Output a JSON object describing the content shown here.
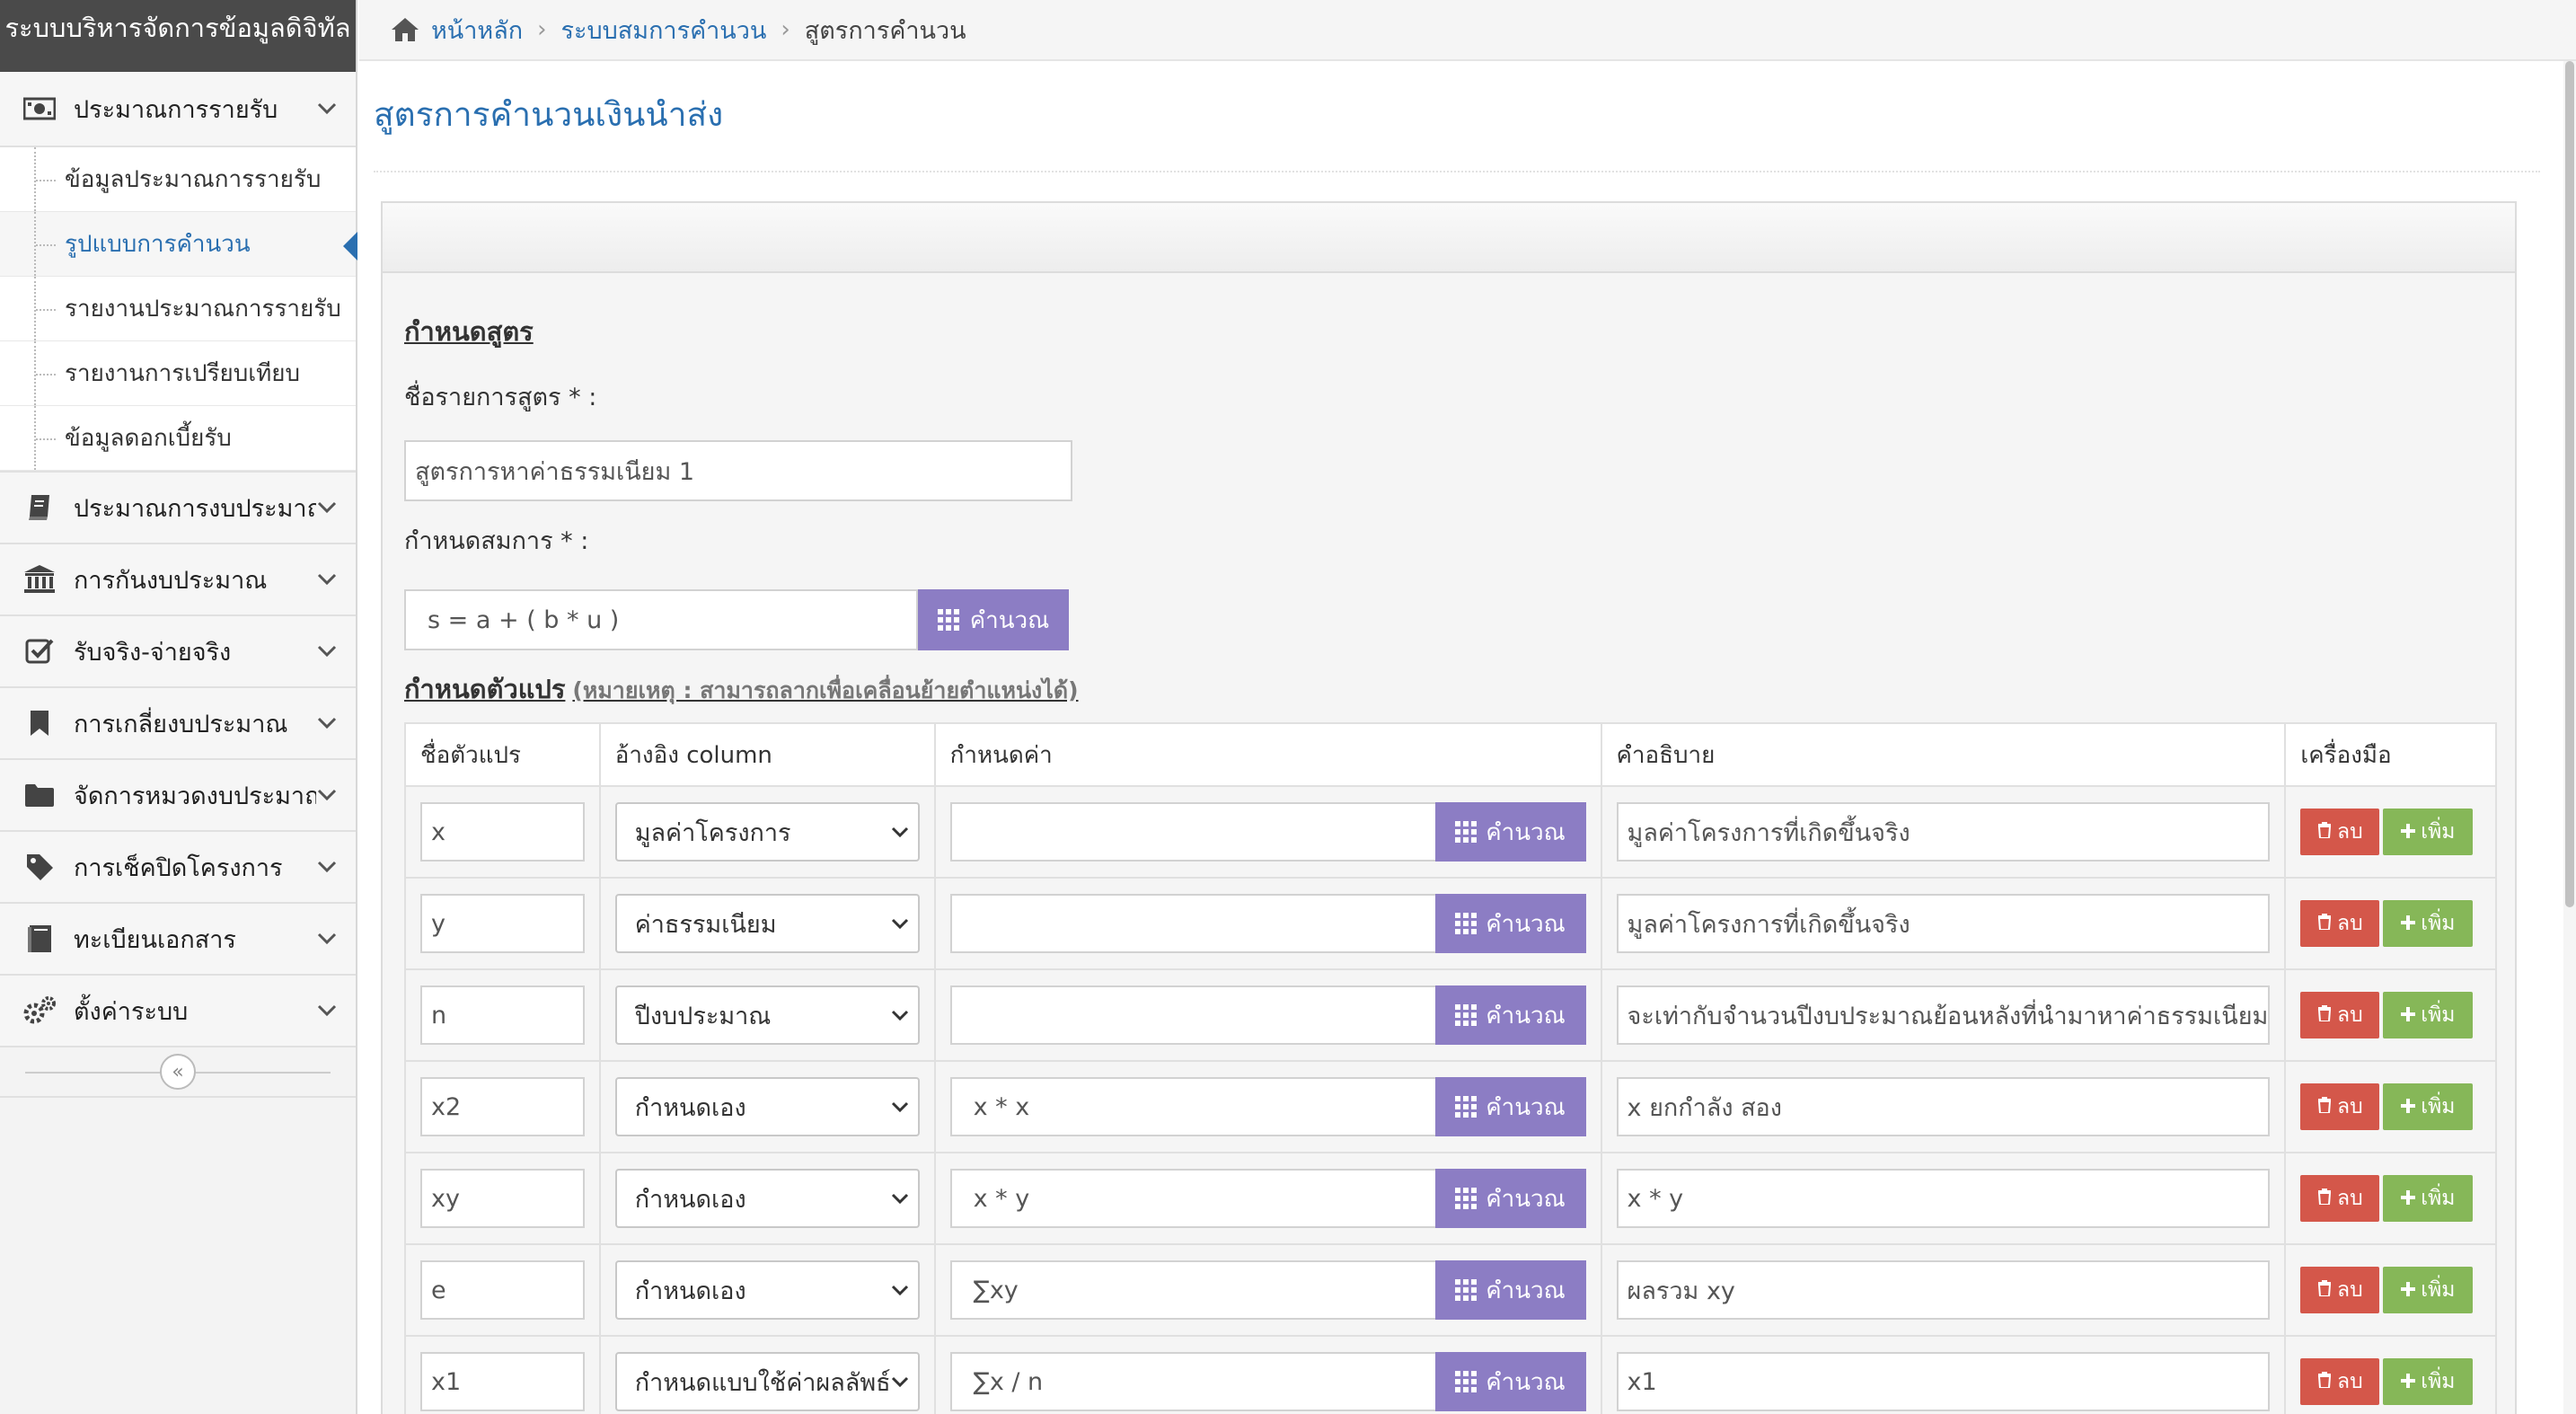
{
  "app": {
    "title": "ระบบบริหารจัดการข้อมูลดิจิทัล"
  },
  "breadcrumb": {
    "home": "หน้าหลัก",
    "parent": "ระบบสมการคำนวน",
    "current": "สูตรการคำนวน"
  },
  "sidebar": {
    "items": [
      {
        "label": "ประมาณการรายรับ",
        "icon": "money-icon",
        "expanded": true,
        "children": [
          {
            "label": "ข้อมูลประมาณการรายรับ"
          },
          {
            "label": "รูปแบบการคำนวน",
            "active": true
          },
          {
            "label": "รายงานประมาณการรายรับ"
          },
          {
            "label": "รายงานการเปรียบเทียบ"
          },
          {
            "label": "ข้อมูลดอกเบี้ยรับ"
          }
        ]
      },
      {
        "label": "ประมาณการงบประมาณ",
        "icon": "book-icon"
      },
      {
        "label": "การกันงบประมาณ",
        "icon": "bank-icon"
      },
      {
        "label": "รับจริง-จ่ายจริง",
        "icon": "check-square-icon"
      },
      {
        "label": "การเกลี่ยงบประมาณ",
        "icon": "bookmark-icon"
      },
      {
        "label": "จัดการหมวดงบประมาณ",
        "icon": "folder-icon"
      },
      {
        "label": "การเช็คปิดโครงการ",
        "icon": "tag-icon"
      },
      {
        "label": "ทะเบียนเอกสาร",
        "icon": "document-book-icon"
      },
      {
        "label": "ตั้งค่าระบบ",
        "icon": "gears-icon"
      }
    ],
    "collapse_label": "«"
  },
  "page": {
    "title": "สูตรการคำนวนเงินนำส่ง",
    "formula_section": "กำหนดสูตร",
    "formula_name_label": "ชื่อรายการสูตร * :",
    "formula_name_value": "สูตรการหาค่าธรรมเนียม 1",
    "equation_label": "กำหนดสมการ * :",
    "equation_value": "s = a + ( b * u )",
    "calc_label": "คำนวณ",
    "variables_section": "กำหนดตัวแปร",
    "variables_note": "(หมายเหตุ : สามารถลากเพื่อเคลื่อนย้ายตำแหน่งได้)"
  },
  "table": {
    "headers": [
      "ชื่อตัวแปร",
      "อ้างอิง column",
      "กำหนดค่า",
      "คำอธิบาย",
      "เครื่องมือ"
    ],
    "delete_label": "ลบ",
    "add_label": "เพิ่ม",
    "rows": [
      {
        "name": "x",
        "ref": "มูลค่าโครงการ",
        "value": "",
        "desc": "มูลค่าโครงการที่เกิดขึ้นจริง"
      },
      {
        "name": "y",
        "ref": "ค่าธรรมเนียม",
        "value": "",
        "desc": "มูลค่าโครงการที่เกิดขึ้นจริง"
      },
      {
        "name": "n",
        "ref": "ปีงบประมาณ",
        "value": "",
        "desc": "จะเท่ากับจำนวนปีงบประมาณย้อนหลังที่นำมาหาค่าธรรมเนียม"
      },
      {
        "name": "x2",
        "ref": "กำหนดเอง",
        "value": "x * x",
        "desc": "x ยกกำลัง สอง"
      },
      {
        "name": "xy",
        "ref": "กำหนดเอง",
        "value": "x * y",
        "desc": "x * y"
      },
      {
        "name": "e",
        "ref": "กำหนดเอง",
        "value": "∑xy",
        "desc": "ผลรวม xy"
      },
      {
        "name": "x1",
        "ref": "กำหนดแบบใช้ค่าผลลัพธ์",
        "value": "∑x / n",
        "desc": "x1"
      }
    ]
  },
  "colors": {
    "accent": "#2a6fb0",
    "calc": "#8c7dc4",
    "delete": "#d4574a",
    "add": "#86b758",
    "brand_bg": "#4a4a4a"
  }
}
